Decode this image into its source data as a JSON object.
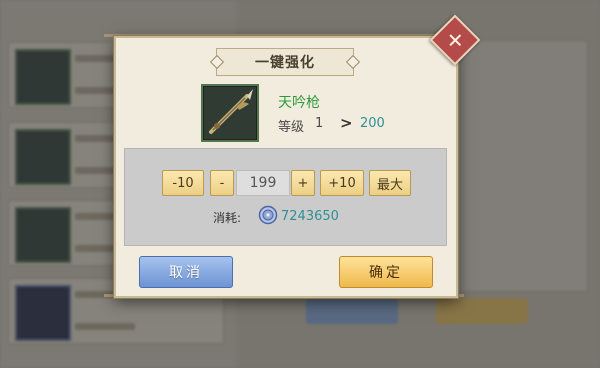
{
  "dialog": {
    "title": "一键强化",
    "close_icon": "close-x-icon",
    "item": {
      "name": "天吟枪",
      "name_color": "#2f9a3c",
      "icon": "spear-weapon-icon",
      "level_label": "等级",
      "level_from": "1",
      "level_arrow": ">",
      "level_to": "200"
    },
    "quantity": {
      "minus10_label": "-10",
      "minus_label": "-",
      "value": "199",
      "plus_label": "+",
      "plus10_label": "+10",
      "max_label": "最大"
    },
    "cost": {
      "label": "消耗:",
      "icon": "silver-coin-icon",
      "value": "7243650"
    },
    "buttons": {
      "cancel_label": "取消",
      "confirm_label": "确定"
    }
  },
  "colors": {
    "cancel": "#7fa0db",
    "confirm": "#f4c862",
    "accent_teal": "#2f8f95"
  }
}
